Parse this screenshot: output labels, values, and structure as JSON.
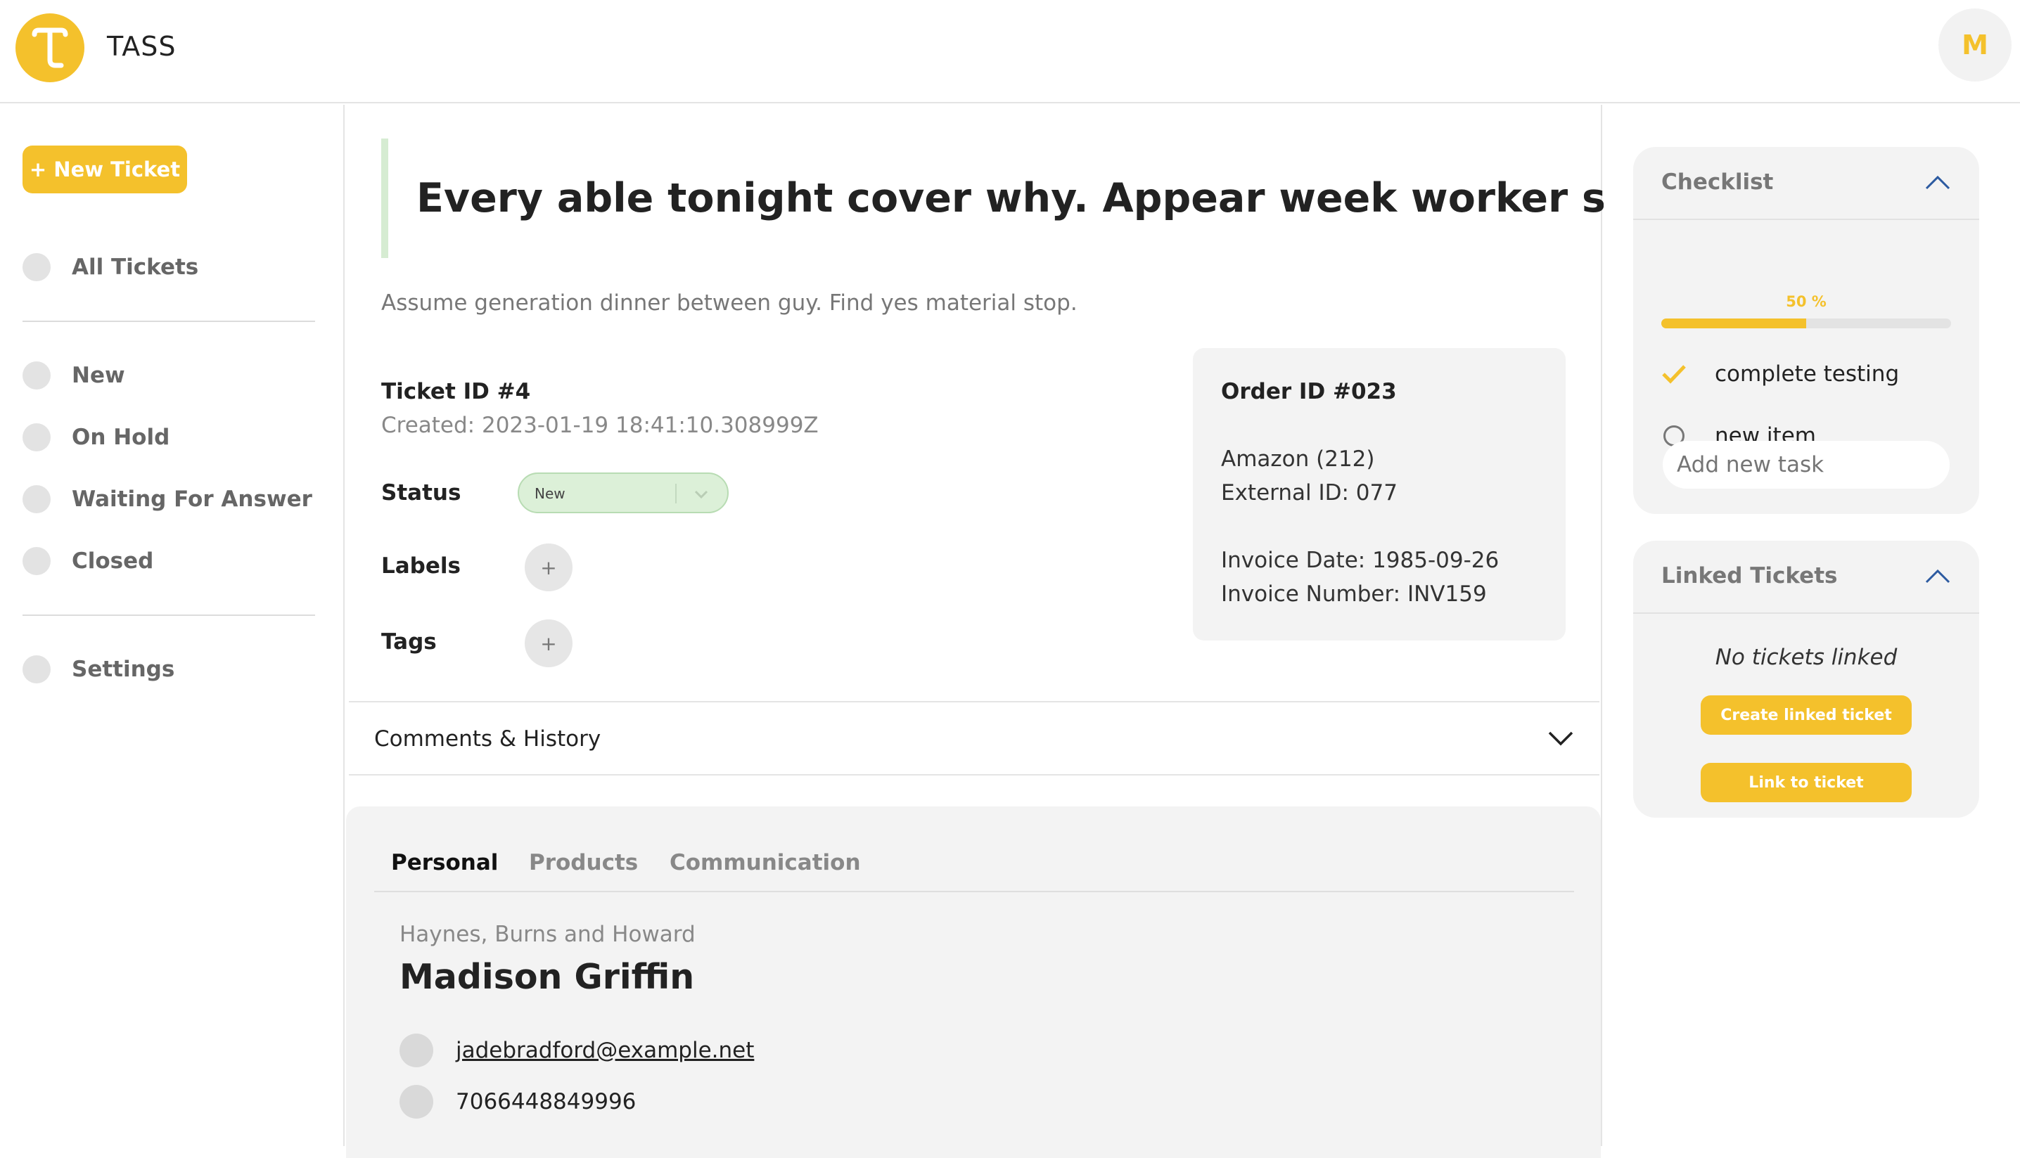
{
  "app": {
    "title": "TASS",
    "logo_letter": "T",
    "user_initial": "M"
  },
  "sidebar": {
    "new_ticket_label": "+ New Ticket",
    "items": [
      {
        "label": "All Tickets"
      },
      {
        "label": "New"
      },
      {
        "label": "On Hold"
      },
      {
        "label": "Waiting For Answer"
      },
      {
        "label": "Closed"
      },
      {
        "label": "Settings"
      }
    ]
  },
  "ticket": {
    "title": "Every able tonight cover why. Appear week worker staff.",
    "description": "Assume generation dinner between guy. Find yes material stop.",
    "id_label": "Ticket ID #4",
    "created": "Created: 2023-01-19 18:41:10.308999Z",
    "status_label": "Status",
    "status_value": "New",
    "labels_label": "Labels",
    "tags_label": "Tags",
    "add_symbol": "+"
  },
  "order": {
    "title": "Order ID #023",
    "shop": "Amazon (212)",
    "external_id": "External ID: 077",
    "invoice_date": "Invoice Date: 1985-09-26",
    "invoice_number": "Invoice Number: INV159"
  },
  "comments": {
    "label": "Comments & History"
  },
  "customer": {
    "tabs": [
      {
        "label": "Personal"
      },
      {
        "label": "Products"
      },
      {
        "label": "Communication"
      }
    ],
    "active_tab": "Personal",
    "company": "Haynes, Burns and Howard",
    "name": "Madison Griffin",
    "email": "jadebradford@example.net",
    "phone": "7066448849996"
  },
  "checklist": {
    "title": "Checklist",
    "progress_text": "50 %",
    "progress_fraction": 0.5,
    "items": [
      {
        "label": "complete testing",
        "done": true
      },
      {
        "label": "new item",
        "done": false
      }
    ],
    "add_placeholder": "Add new task"
  },
  "linked": {
    "title": "Linked Tickets",
    "empty_text": "No tickets linked",
    "create_label": "Create linked ticket",
    "link_label": "Link to ticket"
  },
  "colors": {
    "accent": "#f4c12c",
    "status_bg": "#dcf0d8",
    "panel": "#f3f3f3"
  },
  "icons": [
    "logo-icon",
    "chevron-down-icon",
    "chevron-up-icon",
    "checkmark-icon",
    "circle-icon",
    "plus-icon"
  ]
}
